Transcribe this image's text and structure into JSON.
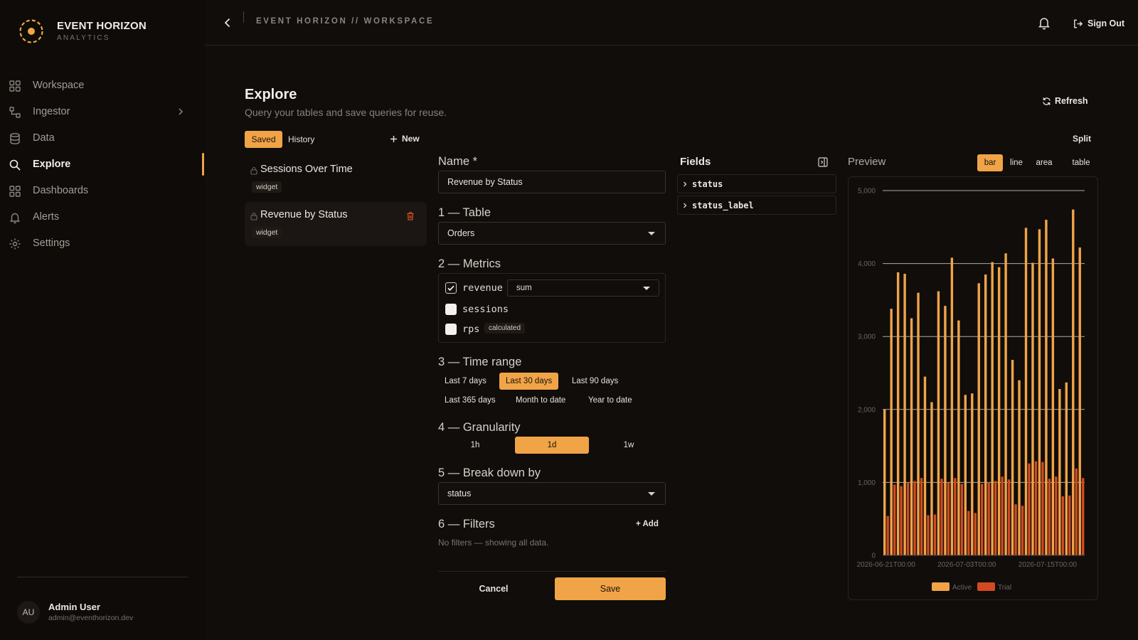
{
  "brand": {
    "name": "EVENT HORIZON",
    "subtitle": "ANALYTICS",
    "accent": "#f0a447"
  },
  "sidebar": {
    "items": [
      {
        "label": "Workspace",
        "icon": "grid-icon"
      },
      {
        "label": "Ingestor",
        "icon": "flow-icon",
        "has_submenu": true
      },
      {
        "label": "Data",
        "icon": "database-icon"
      },
      {
        "label": "Explore",
        "icon": "search-icon",
        "active": true
      },
      {
        "label": "Dashboards",
        "icon": "grid-icon"
      },
      {
        "label": "Alerts",
        "icon": "bell-icon"
      },
      {
        "label": "Settings",
        "icon": "gear-icon"
      }
    ],
    "user": {
      "initials": "AU",
      "name": "Admin User",
      "email": "admin@eventhorizon.dev"
    }
  },
  "topbar": {
    "breadcrumb": "EVENT HORIZON // WORKSPACE",
    "signout_label": "Sign Out"
  },
  "header": {
    "title": "Explore",
    "subtitle": "Query your tables and save queries for reuse.",
    "refresh_label": "Refresh"
  },
  "saved_panel": {
    "tabs": {
      "saved": "Saved",
      "history": "History"
    },
    "new_label": "New",
    "items": [
      {
        "name": "Sessions Over Time",
        "badge": "widget",
        "selected": false
      },
      {
        "name": "Revenue by Status",
        "badge": "widget",
        "selected": true
      }
    ]
  },
  "split_label": "Split",
  "form": {
    "name_label": "Name *",
    "name_value": "Revenue by Status",
    "table_label": "1 — Table",
    "table_value": "Orders",
    "metrics_label": "2 — Metrics",
    "metrics": [
      {
        "name": "revenue",
        "checked": true,
        "aggregation": "sum"
      },
      {
        "name": "sessions",
        "checked": false
      },
      {
        "name": "rps",
        "checked": false,
        "badge": "calculated"
      }
    ],
    "time_label": "3 — Time range",
    "time_options": [
      "Last 7 days",
      "Last 30 days",
      "Last 90 days",
      "Last 365 days",
      "Month to date",
      "Year to date"
    ],
    "time_selected": "Last 30 days",
    "granularity_label": "4 — Granularity",
    "granularity_options": [
      "1h",
      "1d",
      "1w"
    ],
    "granularity_selected": "1d",
    "breakdown_label": "5 — Break down by",
    "breakdown_value": "status",
    "filters_label": "6 — Filters",
    "add_filter_label": "+ Add",
    "no_filters": "No filters — showing all data.",
    "cancel_label": "Cancel",
    "save_label": "Save"
  },
  "fields": {
    "title": "Fields",
    "items": [
      "status",
      "status_label"
    ]
  },
  "preview": {
    "title": "Preview",
    "chart_types": [
      "bar",
      "line",
      "area",
      "table"
    ],
    "selected_type": "bar"
  },
  "chart_data": {
    "type": "bar",
    "grouped": true,
    "x": [
      "2026-06-21",
      "2026-06-22",
      "2026-06-23",
      "2026-06-24",
      "2026-06-25",
      "2026-06-26",
      "2026-06-27",
      "2026-06-28",
      "2026-06-29",
      "2026-06-30",
      "2026-07-01",
      "2026-07-02",
      "2026-07-03",
      "2026-07-04",
      "2026-07-05",
      "2026-07-06",
      "2026-07-07",
      "2026-07-08",
      "2026-07-09",
      "2026-07-10",
      "2026-07-11",
      "2026-07-12",
      "2026-07-13",
      "2026-07-14",
      "2026-07-15",
      "2026-07-16",
      "2026-07-17",
      "2026-07-18",
      "2026-07-19",
      "2026-07-20"
    ],
    "tick_labels": [
      "2026-06-21T00:00",
      "2026-07-03T00:00",
      "2026-07-15T00:00"
    ],
    "series": [
      {
        "name": "Active",
        "color": "#f0a447",
        "values": [
          2000,
          3380,
          3880,
          3860,
          3250,
          3600,
          2450,
          2100,
          3620,
          3420,
          4080,
          3220,
          2200,
          2220,
          3730,
          3850,
          4020,
          3950,
          4140,
          2680,
          2400,
          4490,
          4010,
          4470,
          4600,
          4070,
          2280,
          2370,
          4740,
          4220
        ]
      },
      {
        "name": "Trial",
        "color": "#d24a22",
        "values": [
          540,
          970,
          950,
          1000,
          1020,
          1060,
          550,
          560,
          1050,
          1000,
          1060,
          980,
          610,
          580,
          980,
          1000,
          1020,
          1080,
          1040,
          700,
          680,
          1260,
          1290,
          1280,
          1050,
          1080,
          810,
          820,
          1190,
          1060
        ]
      }
    ],
    "ylim": [
      0,
      5000
    ],
    "yticks": [
      "0",
      "1,000",
      "2,000",
      "3,000",
      "4,000",
      "5,000"
    ],
    "grid": true,
    "legend": "bottom"
  }
}
